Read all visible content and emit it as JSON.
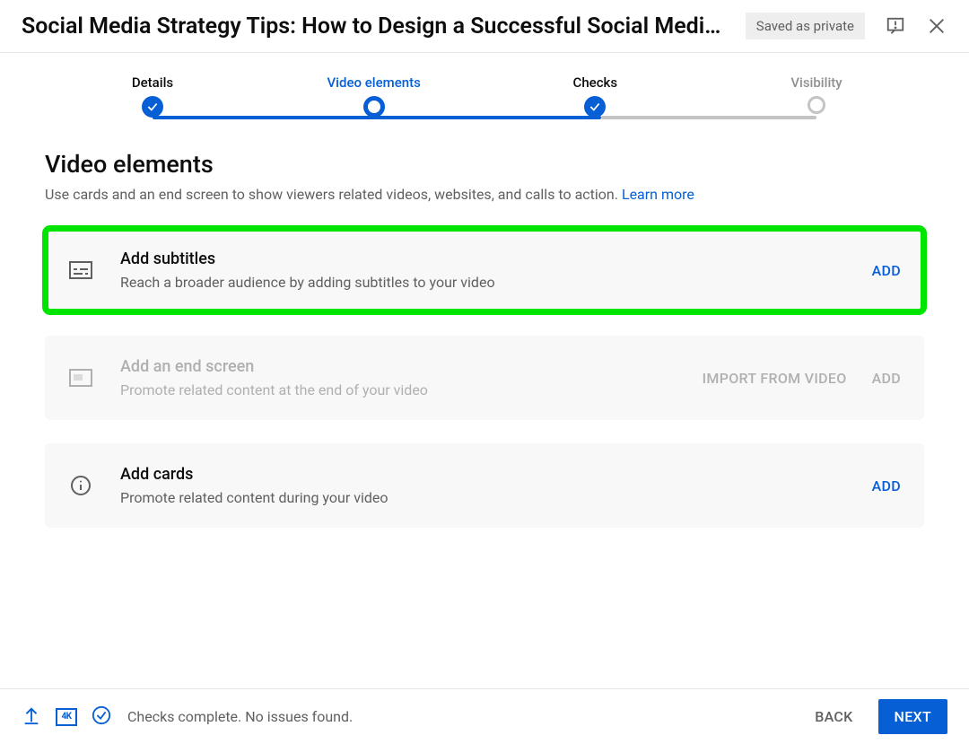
{
  "header": {
    "title": "Social Media Strategy Tips: How to Design a Successful Social Media Mar…",
    "save_status": "Saved as private"
  },
  "stepper": {
    "steps": [
      {
        "label": "Details",
        "state": "done"
      },
      {
        "label": "Video elements",
        "state": "current"
      },
      {
        "label": "Checks",
        "state": "done"
      },
      {
        "label": "Visibility",
        "state": "future"
      }
    ]
  },
  "section": {
    "title": "Video elements",
    "subtitle": "Use cards and an end screen to show viewers related videos, websites, and calls to action. ",
    "learn_more": "Learn more"
  },
  "cards": [
    {
      "icon": "subtitles-icon",
      "title": "Add subtitles",
      "desc": "Reach a broader audience by adding subtitles to your video",
      "actions": [
        {
          "label": "ADD",
          "primary": true
        }
      ],
      "highlight": true,
      "disabled": false
    },
    {
      "icon": "endscreen-icon",
      "title": "Add an end screen",
      "desc": "Promote related content at the end of your video",
      "actions": [
        {
          "label": "IMPORT FROM VIDEO",
          "primary": false
        },
        {
          "label": "ADD",
          "primary": false
        }
      ],
      "highlight": false,
      "disabled": true
    },
    {
      "icon": "info-icon",
      "title": "Add cards",
      "desc": "Promote related content during your video",
      "actions": [
        {
          "label": "ADD",
          "primary": true
        }
      ],
      "highlight": false,
      "disabled": false
    }
  ],
  "footer": {
    "status": "Checks complete. No issues found.",
    "back": "BACK",
    "next": "NEXT",
    "badge_4k": "4K"
  }
}
